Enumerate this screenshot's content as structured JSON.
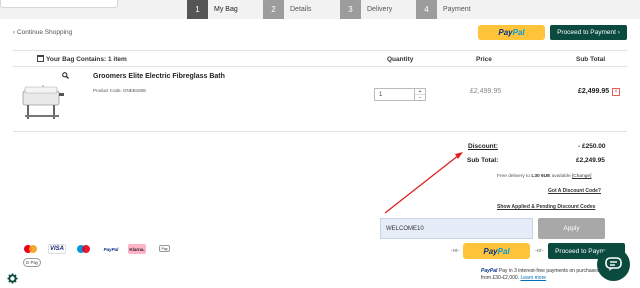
{
  "steps": [
    {
      "num": "1",
      "label": "My Bag"
    },
    {
      "num": "2",
      "label": "Details"
    },
    {
      "num": "3",
      "label": "Delivery"
    },
    {
      "num": "4",
      "label": "Payment"
    }
  ],
  "header": {
    "continue_label": "‹ Continue Shopping",
    "paypal_part1": "Pay",
    "paypal_part2": "Pal",
    "proceed_label": "Proceed to Payment ›"
  },
  "table": {
    "bag_title": "Your Bag Contains: 1 item",
    "col_quantity": "Quantity",
    "col_price": "Price",
    "col_subtotal": "Sub Total"
  },
  "item": {
    "name": "Groomers Elite Electric Fibreglass Bath",
    "code": "Product Code: GNEB180E",
    "quantity": "1",
    "qty_up": "+",
    "qty_down": "−",
    "price": "£2,499.95",
    "subtotal": "£2,499.95",
    "remove": "×"
  },
  "totals": {
    "discount_label": "Discount:",
    "discount_value": "- £250.00",
    "subtotal_label": "Sub Total:",
    "subtotal_value": "£2,249.95",
    "delivery_prefix": "Free delivery to ",
    "delivery_code": "L30 6UE",
    "delivery_suffix": " available ",
    "delivery_change": "[Change]",
    "discount_code_link": "Got A Discount Code?",
    "applied_codes_link": "Show Applied & Pending Discount Codes"
  },
  "coupon": {
    "value": "WELCOME10",
    "apply_label": "Apply"
  },
  "bottom": {
    "or1": "-or-",
    "or2": "-or-",
    "paypal_part1": "Pay",
    "paypal_part2": "Pal",
    "proceed_label": "Proceed to Payment ›",
    "paypal_info_brand": "PayPal",
    "paypal_info_text": " Pay in 3 interest-free payments on purchases from £30-£2,000. ",
    "paypal_info_link": "Learn more"
  },
  "payment_icons": {
    "visa": "VISA",
    "paypal": "PayPal",
    "klarna": "Klarna.",
    "applepay": "Pay",
    "gpay": "G Pay"
  },
  "colors": {
    "accent": "#0b4a3f",
    "paypal_yellow": "#ffc43a",
    "coupon_bg": "#e6edf8",
    "arrow": "#e02020"
  }
}
